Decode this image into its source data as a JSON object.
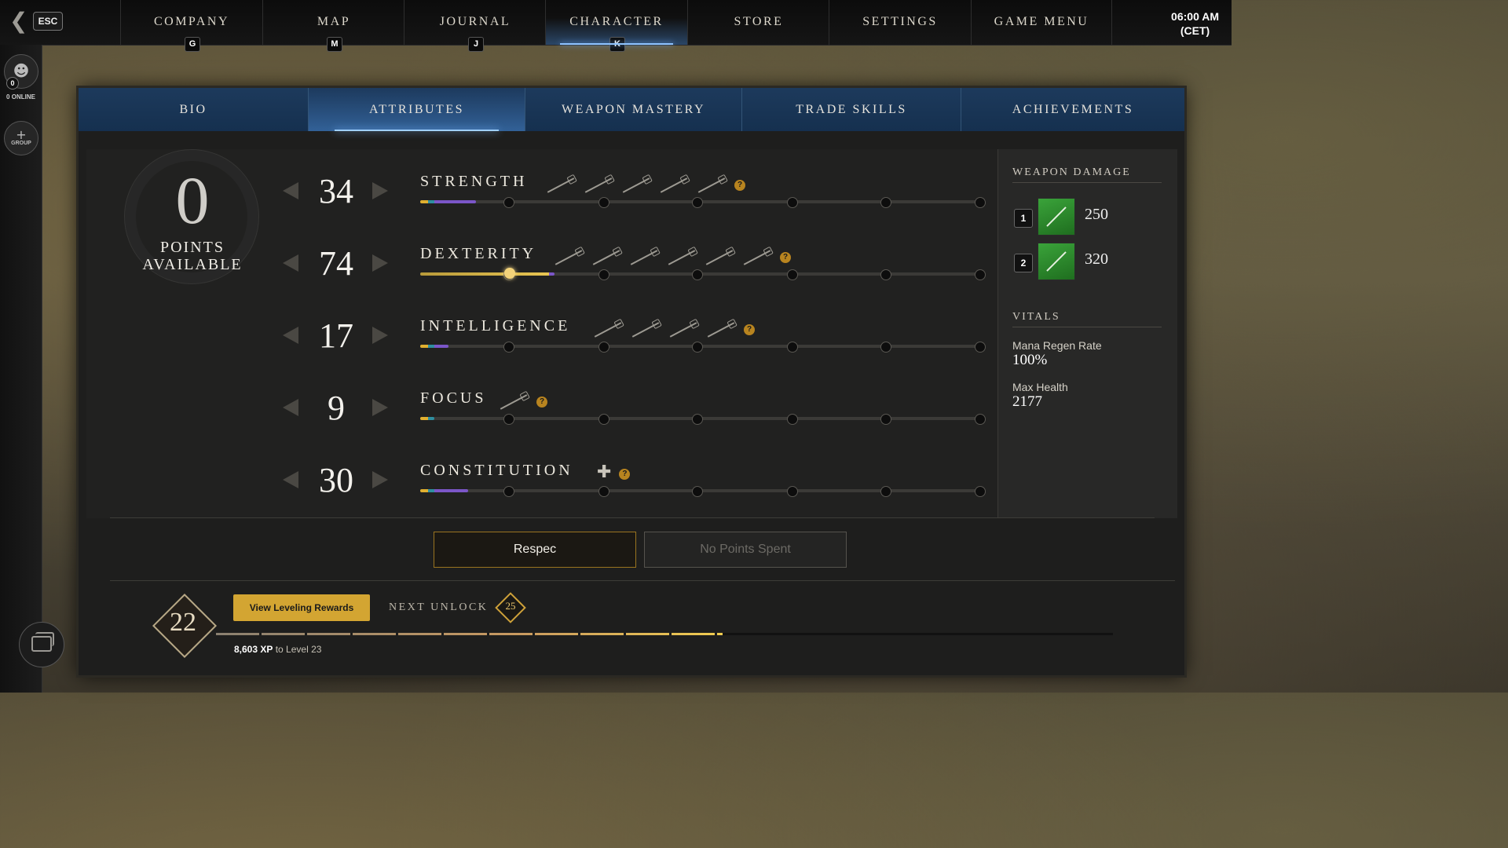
{
  "topbar": {
    "esc_label": "ESC",
    "tabs": [
      {
        "label": "COMPANY",
        "key": "G"
      },
      {
        "label": "MAP",
        "key": "M"
      },
      {
        "label": "JOURNAL",
        "key": "J"
      },
      {
        "label": "CHARACTER",
        "key": "K"
      },
      {
        "label": "STORE",
        "key": ""
      },
      {
        "label": "SETTINGS",
        "key": ""
      },
      {
        "label": "GAME MENU",
        "key": ""
      }
    ],
    "active_tab": "CHARACTER",
    "clock_time": "06:00 AM",
    "clock_zone": "(CET)"
  },
  "leftrail": {
    "online_count": "0",
    "online_label": "0 ONLINE",
    "group_label": "GROUP"
  },
  "subtabs": {
    "items": [
      "BIO",
      "ATTRIBUTES",
      "WEAPON MASTERY",
      "TRADE SKILLS",
      "ACHIEVEMENTS"
    ],
    "active": "ATTRIBUTES"
  },
  "points": {
    "value": "0",
    "label_line1": "POINTS",
    "label_line2": "AVAILABLE"
  },
  "attributes": [
    {
      "name": "STRENGTH",
      "value": "34",
      "weapons": [
        "sword-icon",
        "hatchet-icon",
        "war-hammer-icon",
        "great-axe-icon",
        "spear-icon"
      ],
      "progress": 0.1
    },
    {
      "name": "DEXTERITY",
      "value": "74",
      "weapons": [
        "spear-icon",
        "musket-icon",
        "rapier-icon",
        "bow-icon",
        "hatchet-icon",
        "sword-icon"
      ],
      "progress": 0.24,
      "thumb": 0.16
    },
    {
      "name": "INTELLIGENCE",
      "value": "17",
      "weapons": [
        "fire-staff-icon",
        "void-gauntlet-icon",
        "rapier-icon",
        "blunderbuss-icon"
      ],
      "progress": 0.05
    },
    {
      "name": "FOCUS",
      "value": "9",
      "weapons": [
        "life-staff-icon"
      ],
      "progress": 0.025
    },
    {
      "name": "CONSTITUTION",
      "value": "30",
      "weapons": [],
      "progress": 0.085
    }
  ],
  "weapon_damage": {
    "heading": "WEAPON DAMAGE",
    "slots": [
      {
        "key": "1",
        "weapon": "bow-icon",
        "value": "250"
      },
      {
        "key": "2",
        "weapon": "spear-icon",
        "value": "320"
      }
    ]
  },
  "vitals": {
    "heading": "VITALS",
    "items": [
      {
        "label": "Mana Regen Rate",
        "value": "100%"
      },
      {
        "label": "Max Health",
        "value": "2177"
      }
    ]
  },
  "actions": {
    "respec_label": "Respec",
    "no_points_label": "No Points Spent"
  },
  "leveling": {
    "level": "22",
    "rewards_label": "View Leveling Rewards",
    "next_unlock_label": "NEXT UNLOCK",
    "next_unlock_level": "25",
    "xp_amount": "8,603 XP",
    "xp_suffix": " to Level 23",
    "xp_progress": 0.565
  },
  "colors": {
    "accent_gold": "#d3a532",
    "tab_blue": "#1d3a5c",
    "highlight_blue": "#8ec3ff",
    "weapon_slot_green": "#3aa33a"
  }
}
